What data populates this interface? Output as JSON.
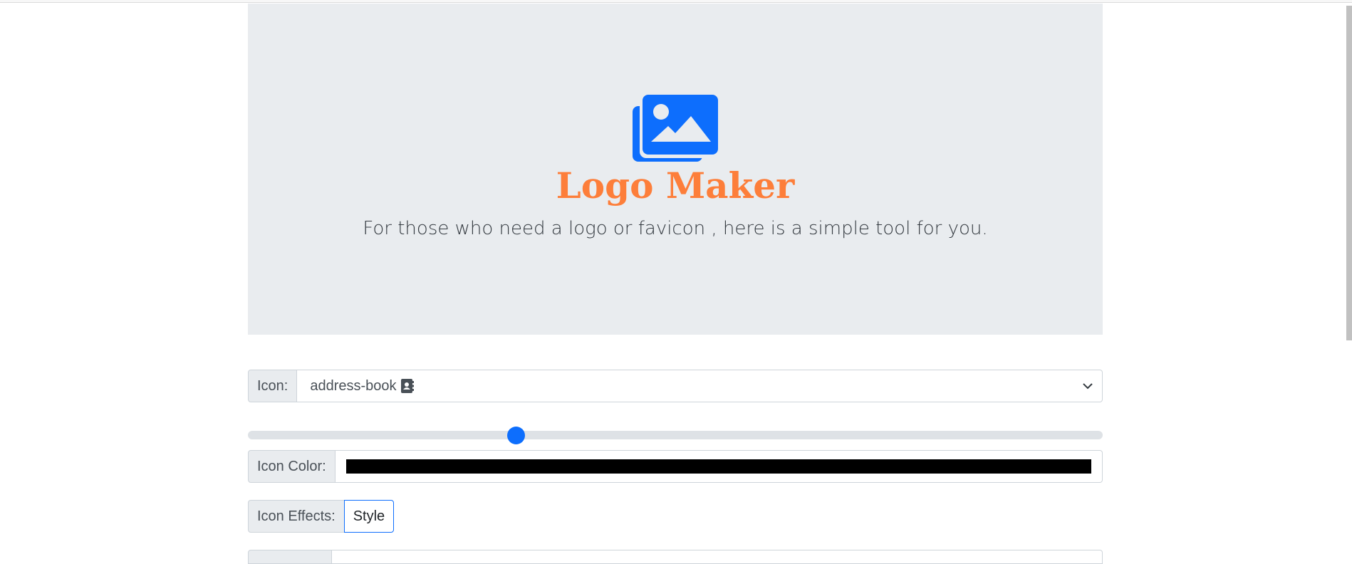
{
  "hero": {
    "logo_icon": "images-icon",
    "title": "Logo Maker",
    "lead": "For those who need a logo or favicon , here is a simple tool for you."
  },
  "icon_field": {
    "label": "Icon:",
    "selected_value": "address-book",
    "selected_icon": "address-book-icon"
  },
  "size_slider": {
    "value_fraction": 0.31
  },
  "icon_color_field": {
    "label": "Icon Color:",
    "value": "#000000"
  },
  "icon_effects_field": {
    "label": "Icon Effects:",
    "button_label": "Style"
  },
  "colors": {
    "accent": "#0d6efd",
    "title": "#fd7e3a",
    "hero_bg": "#e9ecef"
  }
}
